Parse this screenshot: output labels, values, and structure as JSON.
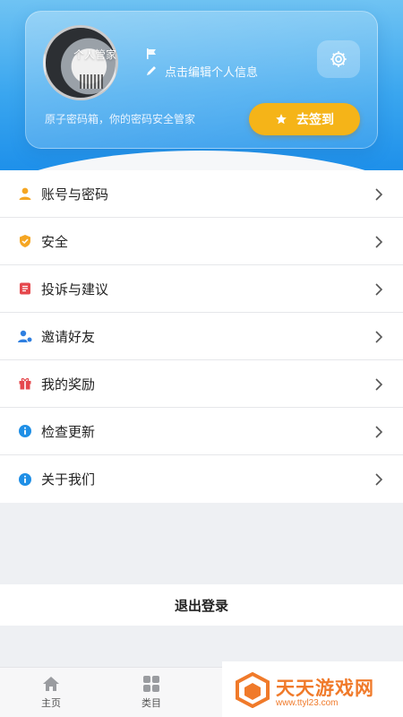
{
  "profile": {
    "avatar_text": "个人管家",
    "edit_label": "点击编辑个人信息",
    "tagline": "原子密码箱，你的密码安全管家",
    "checkin_label": "去签到"
  },
  "menu": {
    "items": [
      {
        "label": "账号与密码",
        "icon": "user-icon",
        "color": "#f5a623"
      },
      {
        "label": "安全",
        "icon": "shield-icon",
        "color": "#f5a623"
      },
      {
        "label": "投诉与建议",
        "icon": "feedback-icon",
        "color": "#e5484d"
      },
      {
        "label": "邀请好友",
        "icon": "invite-user-icon",
        "color": "#2f7fe0"
      },
      {
        "label": "我的奖励",
        "icon": "gift-icon",
        "color": "#e5484d"
      },
      {
        "label": "检查更新",
        "icon": "info-icon",
        "color": "#1f8fe6"
      },
      {
        "label": "关于我们",
        "icon": "info-icon",
        "color": "#1f8fe6"
      }
    ]
  },
  "logout_label": "退出登录",
  "bottom_nav": {
    "home_label": "主页",
    "category_label": "类目"
  },
  "watermark": {
    "title": "天天游戏网",
    "url": "www.ttyl23.com"
  },
  "colors": {
    "header_blue": "#3aa6ef",
    "accent_yellow": "#f5b418",
    "watermark_orange": "#f07a2a"
  }
}
